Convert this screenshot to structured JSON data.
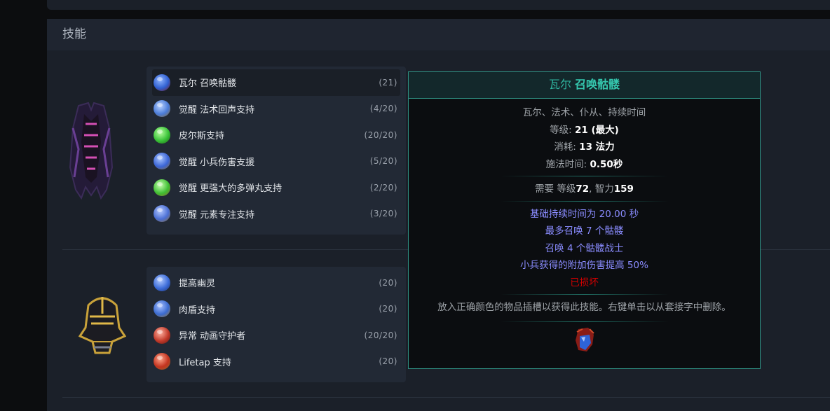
{
  "panel": {
    "title": "技能"
  },
  "groups": [
    {
      "item_icon": "dark-chest-armour-icon",
      "gems": [
        {
          "name": "瓦尔 召唤骷髅",
          "level": "(21)",
          "icon": "vaal-skeleton-gem-icon",
          "color": "#2f5fd1",
          "active": true
        },
        {
          "name": "觉醒 法术回声支持",
          "level": "(4/20)",
          "icon": "awakened-echo-gem-icon",
          "color": "#4a7bd8"
        },
        {
          "name": "皮尔斯支持",
          "level": "(20/20)",
          "icon": "pierce-gem-icon",
          "color": "#39c238"
        },
        {
          "name": "觉醒 小兵伤害支援",
          "level": "(5/20)",
          "icon": "awakened-minion-damage-gem-icon",
          "color": "#3a64d6"
        },
        {
          "name": "觉醒 更强大的多弹丸支持",
          "level": "(2/20)",
          "icon": "awakened-gmp-gem-icon",
          "color": "#3fbf33"
        },
        {
          "name": "觉醒 元素专注支持",
          "level": "(3/20)",
          "icon": "awakened-elemental-focus-gem-icon",
          "color": "#4a6ed4"
        }
      ]
    },
    {
      "item_icon": "gold-helmet-icon",
      "gems": [
        {
          "name": "提高幽灵",
          "level": "(20)",
          "icon": "raise-spectre-gem-icon",
          "color": "#3c6cd8"
        },
        {
          "name": "肉盾支持",
          "level": "(20)",
          "icon": "meat-shield-gem-icon",
          "color": "#3a6ad0"
        },
        {
          "name": "异常 动画守护者",
          "level": "(20/20)",
          "icon": "animate-guardian-gem-icon",
          "color": "#c23a2a"
        },
        {
          "name": "Lifetap 支持",
          "level": "(20)",
          "icon": "lifetap-gem-icon",
          "color": "#c3331f"
        }
      ]
    }
  ],
  "tooltip": {
    "title_prefix": "瓦尔",
    "title_name": "召唤骷髅",
    "tags": "瓦尔、法术、仆从、持续时间",
    "level_label": "等级:",
    "level_value": "21 (最大)",
    "cost_label": "消耗:",
    "cost_value": "13 法力",
    "cast_label": "施法时间:",
    "cast_value": "0.50秒",
    "req_prefix": "需要 等级",
    "req_level": "72",
    "req_int_label": ", 智力",
    "req_int": "159",
    "mods": [
      "基础持续时间为 20.00 秒",
      "最多召唤 7 个骷髅",
      "召唤 4 个骷髅战士",
      "小兵获得的附加伤害提高 50%"
    ],
    "corrupted": "已损坏",
    "description": "放入正确颜色的物品插槽以获得此技能。右键单击以从套接字中删除。",
    "gem_icon": "vaal-skeleton-gem-icon"
  }
}
